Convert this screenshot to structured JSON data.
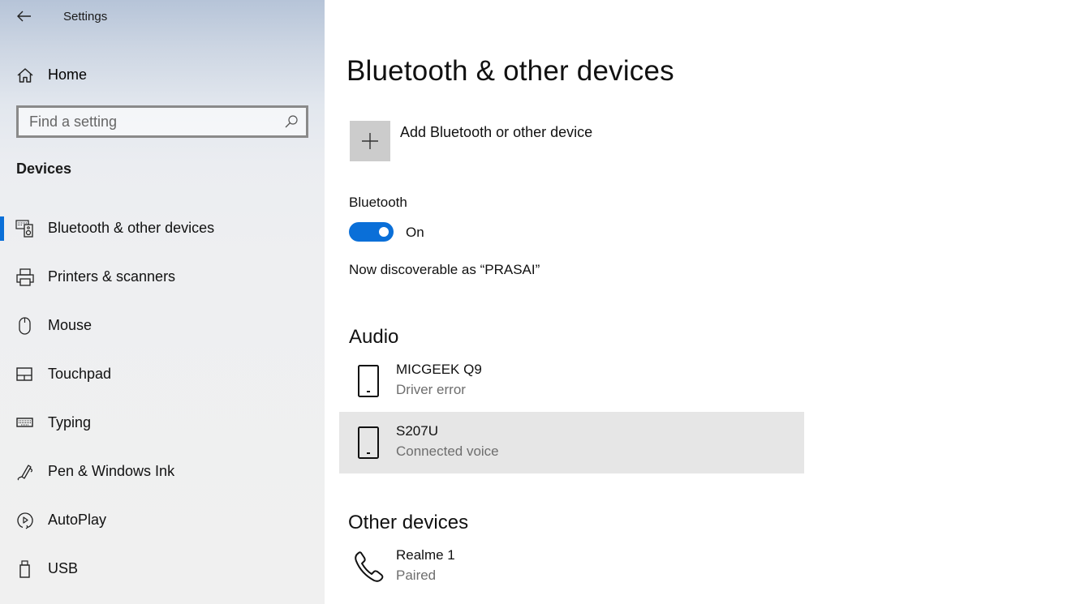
{
  "window": {
    "title": "Settings",
    "back_icon": "arrow-left-icon"
  },
  "sidebar": {
    "home": {
      "label": "Home",
      "icon": "home-icon"
    },
    "search": {
      "placeholder": "Find a setting",
      "value": "",
      "icon": "search-icon"
    },
    "section": "Devices",
    "items": [
      {
        "label": "Bluetooth & other devices",
        "icon": "bluetooth-devices-icon",
        "selected": true
      },
      {
        "label": "Printers & scanners",
        "icon": "printer-icon",
        "selected": false
      },
      {
        "label": "Mouse",
        "icon": "mouse-icon",
        "selected": false
      },
      {
        "label": "Touchpad",
        "icon": "touchpad-icon",
        "selected": false
      },
      {
        "label": "Typing",
        "icon": "keyboard-icon",
        "selected": false
      },
      {
        "label": "Pen & Windows Ink",
        "icon": "pen-icon",
        "selected": false
      },
      {
        "label": "AutoPlay",
        "icon": "autoplay-icon",
        "selected": false
      },
      {
        "label": "USB",
        "icon": "usb-icon",
        "selected": false
      }
    ],
    "accent_color": "#0a6fd8"
  },
  "main": {
    "title": "Bluetooth & other devices",
    "add_device": {
      "label": "Add Bluetooth or other device",
      "icon": "plus-icon"
    },
    "bluetooth": {
      "label": "Bluetooth",
      "state": "On",
      "enabled": true,
      "discoverable_text": "Now discoverable as “PRASAI”"
    },
    "groups": [
      {
        "heading": "Audio",
        "devices": [
          {
            "name": "MICGEEK Q9",
            "status": "Driver error",
            "icon": "phone-device-icon",
            "selected": false
          },
          {
            "name": "S207U",
            "status": "Connected voice",
            "icon": "phone-device-icon",
            "selected": true
          }
        ]
      },
      {
        "heading": "Other devices",
        "devices": [
          {
            "name": "Realme 1",
            "status": "Paired",
            "icon": "phone-handset-icon",
            "selected": false
          }
        ]
      }
    ]
  }
}
